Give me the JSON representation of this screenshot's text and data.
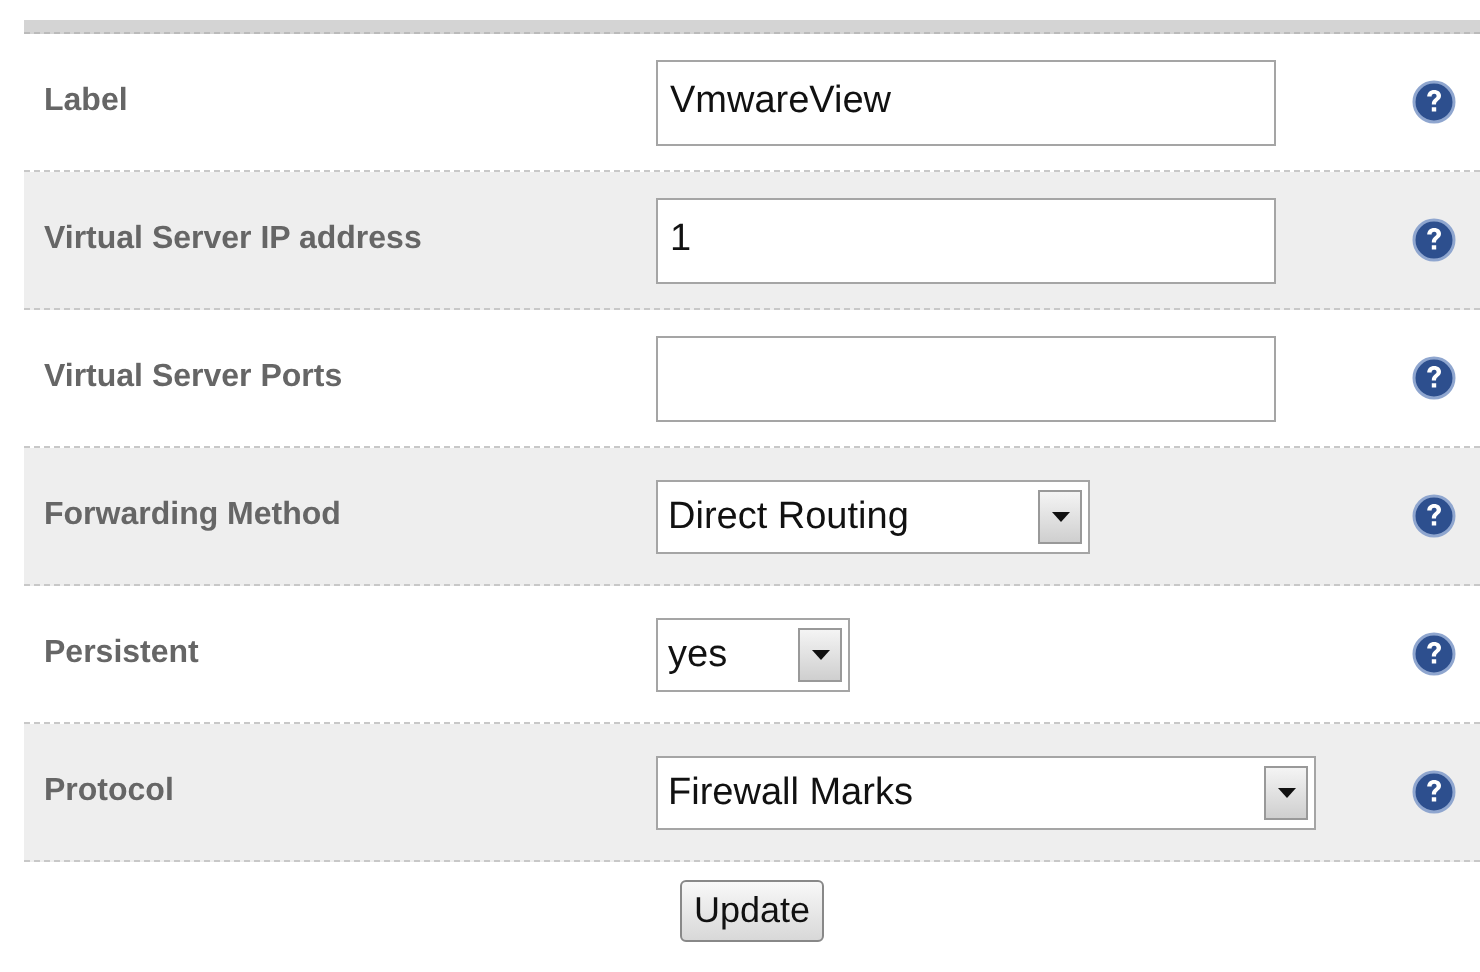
{
  "fields": [
    {
      "label": "Label",
      "kind": "text",
      "value": "VmwareView"
    },
    {
      "label": "Virtual Server IP address",
      "kind": "text",
      "value": "1"
    },
    {
      "label": "Virtual Server Ports",
      "kind": "text"
    },
    {
      "label": "Forwarding Method",
      "kind": "select",
      "value": "Direct Routing"
    },
    {
      "label": "Persistent",
      "kind": "select",
      "value": "yes"
    },
    {
      "label": "Protocol",
      "kind": "select",
      "value": "Firewall Marks"
    }
  ],
  "button": "Update"
}
